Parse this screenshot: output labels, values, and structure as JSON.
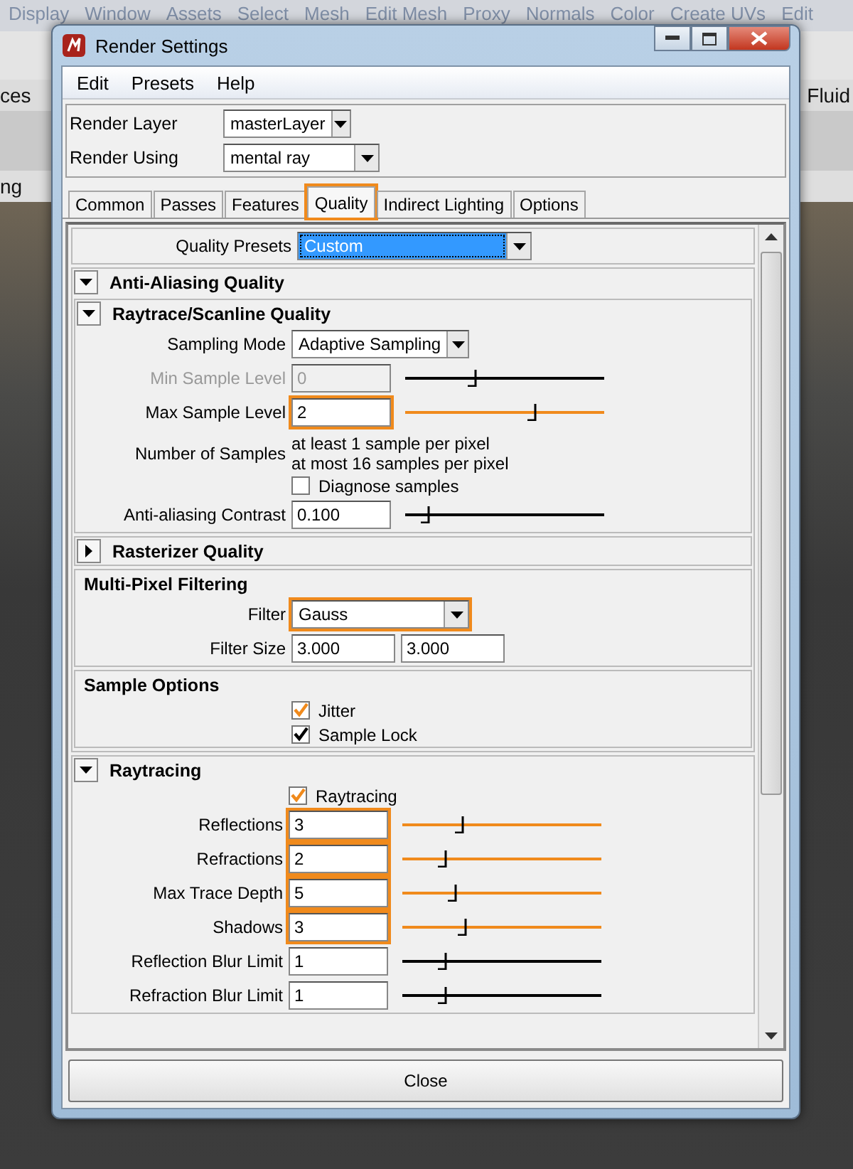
{
  "background_app": {
    "menu_bar": [
      "Display",
      "Window",
      "Assets",
      "Select",
      "Mesh",
      "Edit Mesh",
      "Proxy",
      "Normals",
      "Color",
      "Create UVs",
      "Edit"
    ],
    "left_shelf_tab": "ces",
    "left_panel_tab": "ng",
    "right_shelf_tab": "Fluid"
  },
  "window": {
    "title": "Render Settings"
  },
  "menu_bar": [
    "Edit",
    "Presets",
    "Help"
  ],
  "render_layer": {
    "label": "Render Layer",
    "value": "masterLayer"
  },
  "render_using": {
    "label": "Render Using",
    "value": "mental ray"
  },
  "tabs": [
    {
      "label": "Common",
      "selected": false,
      "highlighted": false
    },
    {
      "label": "Passes",
      "selected": false,
      "highlighted": false
    },
    {
      "label": "Features",
      "selected": false,
      "highlighted": false
    },
    {
      "label": "Quality",
      "selected": true,
      "highlighted": true
    },
    {
      "label": "Indirect Lighting",
      "selected": false,
      "highlighted": false
    },
    {
      "label": "Options",
      "selected": false,
      "highlighted": false
    }
  ],
  "quality_presets": {
    "label": "Quality Presets",
    "value": "Custom",
    "focused": true
  },
  "sections": [
    {
      "title": "Anti-Aliasing Quality",
      "kind": "collapsible",
      "expanded": true,
      "subsections": [
        {
          "title": "Raytrace/Scanline Quality",
          "kind": "collapsible",
          "expanded": true,
          "rows": [
            {
              "kind": "dropdown",
              "label": "Sampling Mode",
              "value": "Adaptive Sampling",
              "highlighted": false
            },
            {
              "kind": "slider",
              "label": "Min Sample Level",
              "value": "0",
              "level": 0.36,
              "disabled": true,
              "highlighted": false
            },
            {
              "kind": "slider",
              "label": "Max Sample Level",
              "value": "2",
              "level": 0.66,
              "disabled": false,
              "highlighted": true
            },
            {
              "kind": "text",
              "label": "Number of Samples",
              "lines": [
                "at least 1 sample per pixel",
                "at most 16 samples per pixel"
              ]
            },
            {
              "kind": "checkbox",
              "label": "Diagnose samples",
              "checked": false
            },
            {
              "kind": "slider",
              "label": "Anti-aliasing Contrast",
              "value": "0.100",
              "level": 0.12,
              "disabled": false,
              "highlighted": false
            }
          ]
        },
        {
          "title": "Rasterizer Quality",
          "kind": "collapsible",
          "expanded": false
        },
        {
          "title": "Multi-Pixel Filtering",
          "kind": "plain",
          "rows": [
            {
              "kind": "dropdown",
              "label": "Filter",
              "value": "Gauss",
              "highlighted": true
            },
            {
              "kind": "pair",
              "label": "Filter Size",
              "values": [
                "3.000",
                "3.000"
              ]
            }
          ]
        },
        {
          "title": "Sample Options",
          "kind": "plain",
          "rows": [
            {
              "kind": "checkbox",
              "label": "Jitter",
              "checked": true,
              "highlighted": true
            },
            {
              "kind": "checkbox",
              "label": "Sample Lock",
              "checked": true,
              "highlighted": false
            }
          ]
        }
      ]
    },
    {
      "title": "Raytracing",
      "kind": "collapsible",
      "expanded": true,
      "rows": [
        {
          "kind": "checkbox",
          "label": "Raytracing",
          "checked": true,
          "highlighted": true
        },
        {
          "kind": "slider",
          "label": "Reflections",
          "value": "3",
          "level": 0.31,
          "disabled": false,
          "highlighted": true
        },
        {
          "kind": "slider",
          "label": "Refractions",
          "value": "2",
          "level": 0.22,
          "disabled": false,
          "highlighted": true
        },
        {
          "kind": "slider",
          "label": "Max Trace Depth",
          "value": "5",
          "level": 0.27,
          "disabled": false,
          "highlighted": true
        },
        {
          "kind": "slider",
          "label": "Shadows",
          "value": "3",
          "level": 0.32,
          "disabled": false,
          "highlighted": true
        },
        {
          "kind": "slider",
          "label": "Reflection Blur Limit",
          "value": "1",
          "level": 0.22,
          "disabled": false,
          "highlighted": false
        },
        {
          "kind": "slider",
          "label": "Refraction Blur Limit",
          "value": "1",
          "level": 0.22,
          "disabled": false,
          "highlighted": false
        }
      ]
    }
  ],
  "close_button": "Close"
}
